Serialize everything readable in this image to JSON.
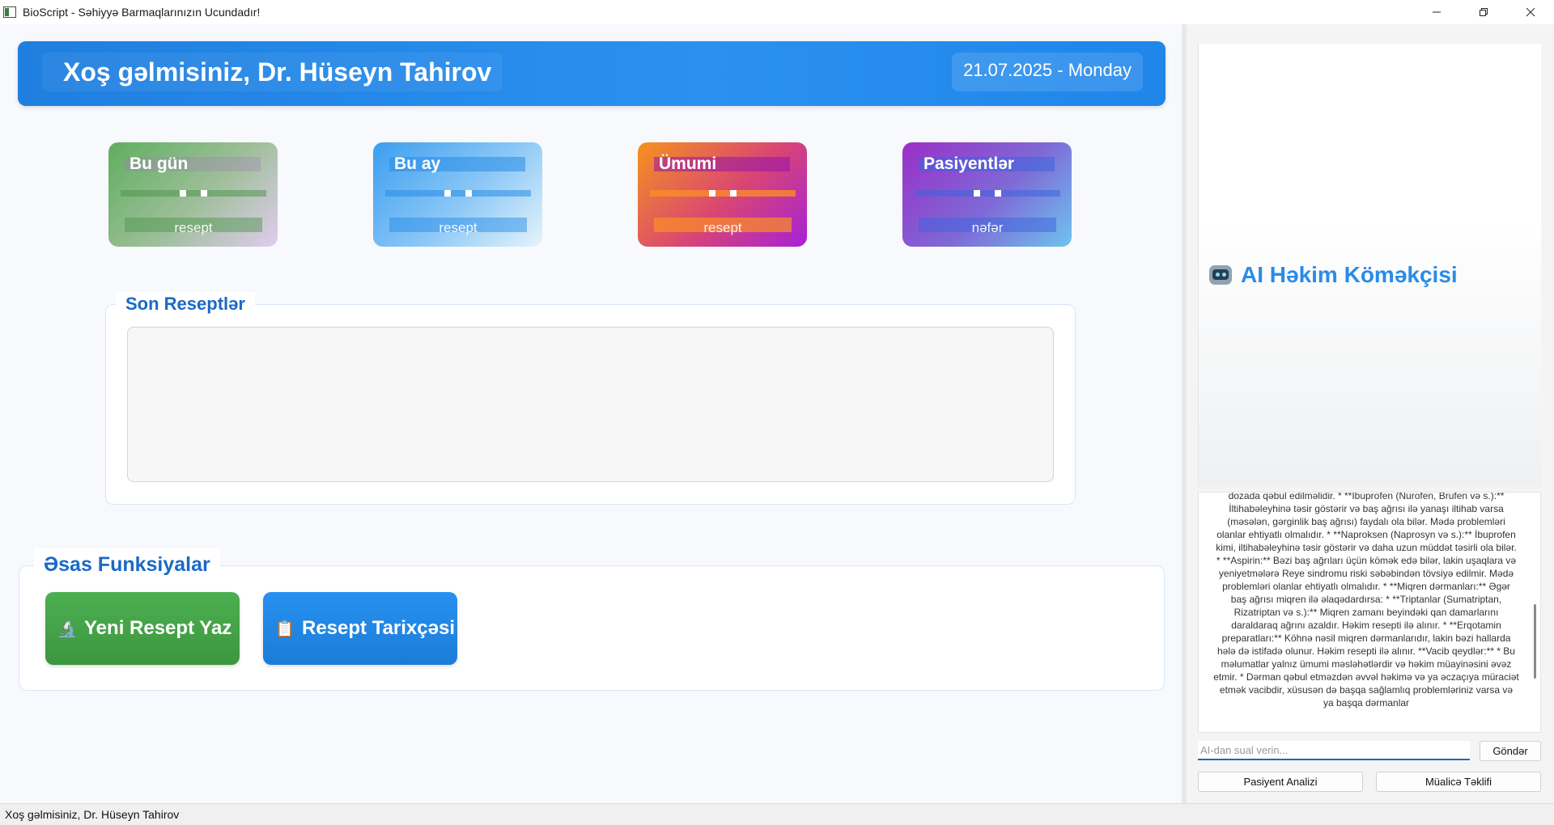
{
  "window": {
    "title": "BioScript - Səhiyyə Barmaqlarınızın Ucundadır!",
    "controls": [
      "minimize",
      "maximize",
      "close"
    ]
  },
  "header": {
    "welcome": "Xoş gəlmisiniz, Dr. Hüseyn Tahirov",
    "date": "21.07.2025 - Monday"
  },
  "stats": [
    {
      "title": "Bu gün",
      "sub": "resept"
    },
    {
      "title": "Bu ay",
      "sub": "resept"
    },
    {
      "title": "Ümumi",
      "sub": "resept"
    },
    {
      "title": "Pasiyentlər",
      "sub": "nəfər"
    }
  ],
  "recent": {
    "title": "Son Reseptlər"
  },
  "functions": {
    "title": "Əsas Funksiyalar",
    "new_prescription": {
      "icon": "microscope-icon",
      "glyph": "🔬",
      "label": "Yeni Resept Yaz"
    },
    "history": {
      "icon": "clipboard-icon",
      "glyph": "📋",
      "label": "Resept Tarixçəsi"
    }
  },
  "ai": {
    "title": "AI Həkim Köməkçisi",
    "icon": "robot-icon",
    "response": "dozada qəbul edilməlidir. * **İbuprofen (Nurofen, Brufen və s.):** İltihabəleyhinə təsir göstərir və baş ağrısı ilə yanaşı iltihab varsa (məsələn, gərginlik baş ağrısı) faydalı ola bilər. Mədə problemləri olanlar ehtiyatlı olmalıdır. * **Naproksen (Naprosyn və s.):** İbuprofen kimi, iltihabəleyhinə təsir göstərir və daha uzun müddət təsirli ola bilər. * **Aspirin:** Bəzi baş ağrıları üçün kömək edə bilər, lakin uşaqlara və yeniyetmələrə Reye sindromu riski səbəbindən tövsiyə edilmir. Mədə problemləri olanlar ehtiyatlı olmalıdır. * **Miqren dərmanları:** Əgər baş ağrısı miqren ilə əlaqədardırsa: * **Triptanlar (Sumatriptan, Rizatriptan və s.):** Miqren zamanı beyindəki qan damarlarını daraldaraq ağrını azaldır. Həkim resepti ilə alınır. * **Erqotamin preparatları:** Köhnə nəsil miqren dərmanlarıdır, lakin bəzi hallarda hələ də istifadə olunur. Həkim resepti ilə alınır. **Vacib qeydlər:** * Bu məlumatlar yalnız ümumi məsləhətlərdir və həkim müayinəsini əvəz etmir. * Dərman qəbul etməzdən əvvəl həkimə və ya əczaçıya müraciət etmək vacibdir, xüsusən də başqa sağlamlıq problemləriniz varsa və ya başqa dərmanlar",
    "input_placeholder": "AI-dan sual verin...",
    "send_label": "Göndər",
    "analysis_label": "Pasiyent Analizi",
    "suggest_label": "Müalicə Təklifi"
  },
  "status": {
    "text": "Xoş gəlmisiniz, Dr. Hüseyn Tahirov"
  }
}
